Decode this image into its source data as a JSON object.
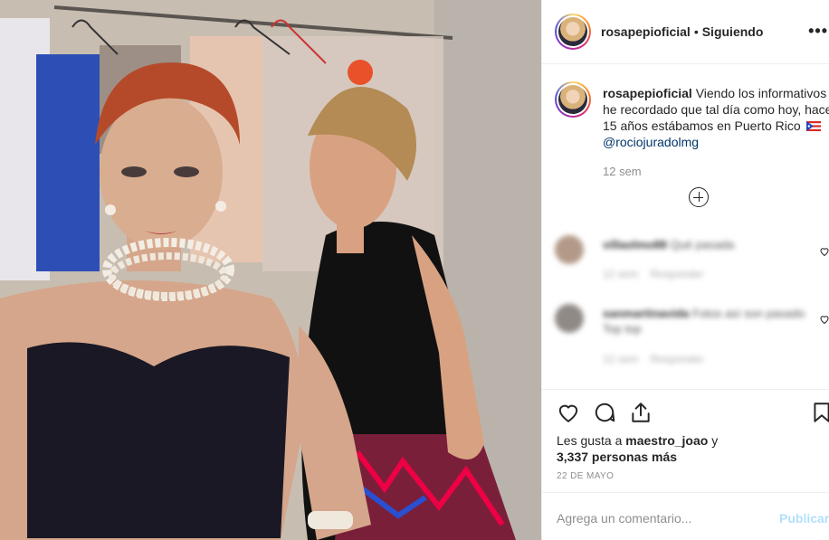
{
  "post": {
    "photo_alt": "",
    "header": {
      "username": "rosapepioficial",
      "separator": "•",
      "follow_status": "Siguiendo",
      "more_label": "•••"
    },
    "caption": {
      "username": "rosapepioficial",
      "text": "Viendo los informativos he recordado que tal día como hoy, hace 15 años estábamos en Puerto Rico",
      "flag_icon": "puerto-rico-flag-icon",
      "mention": "@rociojuradolmg",
      "time": "12 sem"
    },
    "comments": [
      {
        "username": "villaolmo88",
        "text": "Qué pasada",
        "meta_time": "12 sem",
        "meta_reply": "Responder"
      },
      {
        "username": "sanmartinavida",
        "text": "Fotos así son pasado",
        "text2": "Top top",
        "meta_time": "12 sem",
        "meta_reply": "Responder"
      }
    ],
    "actions": {
      "like_icon": "heart-icon",
      "comment_icon": "comment-icon",
      "share_icon": "share-icon",
      "save_icon": "bookmark-icon"
    },
    "likes": {
      "prefix": "Les gusta a ",
      "user": "maestro_joao",
      "middle": " y",
      "count_text": "3,337 personas más"
    },
    "date": "22 DE MAYO",
    "add_comment": {
      "placeholder": "Agrega un comentario...",
      "post_label": "Publicar"
    }
  },
  "colors": {
    "text": "#262626",
    "muted": "#8e8e8e",
    "mention": "#003569",
    "post_disabled": "#b2dffc",
    "divider": "#efefef"
  }
}
